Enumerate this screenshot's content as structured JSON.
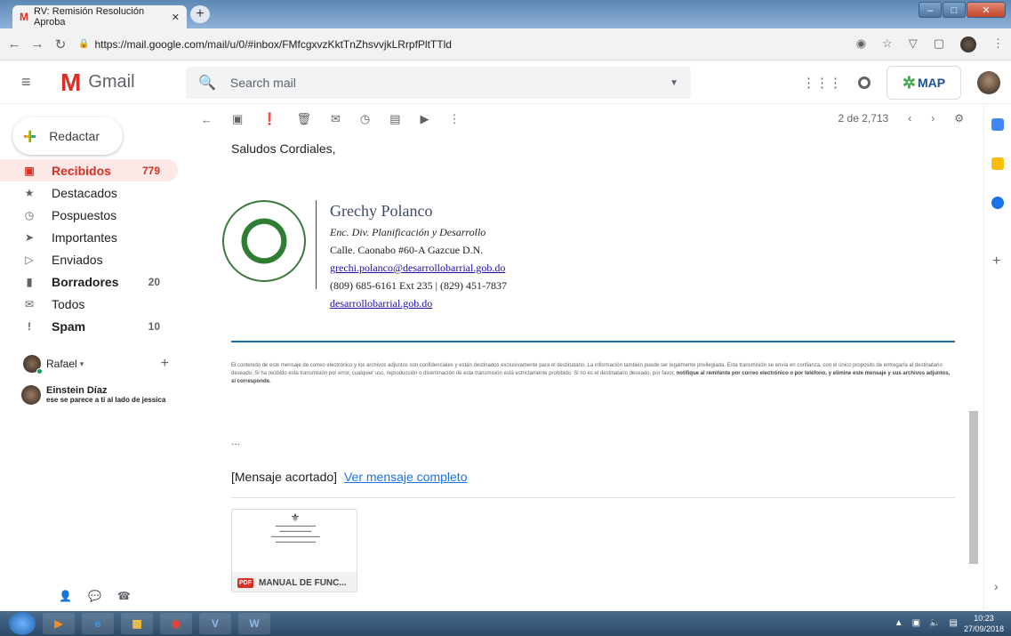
{
  "browser": {
    "tab_title": "RV: Remisión Resolución Aproba",
    "url": "https://mail.google.com/mail/u/0/#inbox/FMfcgxvzKktTnZhsvvjkLRrpfPltTTld"
  },
  "gmail": {
    "logo_text": "Gmail",
    "search_placeholder": "Search mail",
    "compose_label": "Redactar",
    "nav": [
      {
        "label": "Recibidos",
        "count": "779",
        "icon": "inbox-icon"
      },
      {
        "label": "Destacados",
        "count": "",
        "icon": "star-icon"
      },
      {
        "label": "Pospuestos",
        "count": "",
        "icon": "clock-icon"
      },
      {
        "label": "Importantes",
        "count": "",
        "icon": "important-icon"
      },
      {
        "label": "Enviados",
        "count": "",
        "icon": "send-icon"
      },
      {
        "label": "Borradores",
        "count": "20",
        "icon": "draft-icon"
      },
      {
        "label": "Todos",
        "count": "",
        "icon": "mail-icon"
      },
      {
        "label": "Spam",
        "count": "10",
        "icon": "spam-icon"
      }
    ],
    "hangouts_user": "Rafael",
    "contact": {
      "name": "Einstein Díaz",
      "message": "ese se parece a ti al lado de jessica"
    },
    "pagination": "2 de 2,713"
  },
  "email": {
    "greeting": "Saludos Cordiales,",
    "signature": {
      "name": "Grechy Polanco",
      "role": "Enc. Div. Planificación y Desarrollo",
      "address": "Calle. Caonabo #60-A Gazcue D.N.",
      "email": "grechi.polanco@desarrollobarrial.gob.do",
      "phone": "(809) 685-6161 Ext 235 | (829) 451-7837",
      "website": "desarrollobarrial.gob.do"
    },
    "disclaimer_main": "El contenido de este mensaje de correo electrónico y los archivos adjuntos son confidenciales y están destinados exclusivamente para el destinatario. La información también puede ser legalmente privilegiada. Esta transmisión se envía en confianza, con el único propósito de entregarla al destinatario deseado. Si ha recibido esta transmisión por error, cualquier uso, reproducción o diseminación de esta transmisión está estrictamente prohibido. Si no es el destinatario deseado, por favor,",
    "disclaimer_bold": "notifique al remitente por correo electrónico o por teléfono, y elimine este mensaje y sus archivos adjuntos, si corresponde.",
    "ellipsis": "...",
    "trimmed_label": "[Mensaje acortado]",
    "view_full_link": "Ver mensaje completo",
    "attachment_name": "MANUAL DE FUNC...",
    "attachment_type": "PDF"
  },
  "taskbar": {
    "time": "10:23",
    "date": "27/09/2018"
  }
}
